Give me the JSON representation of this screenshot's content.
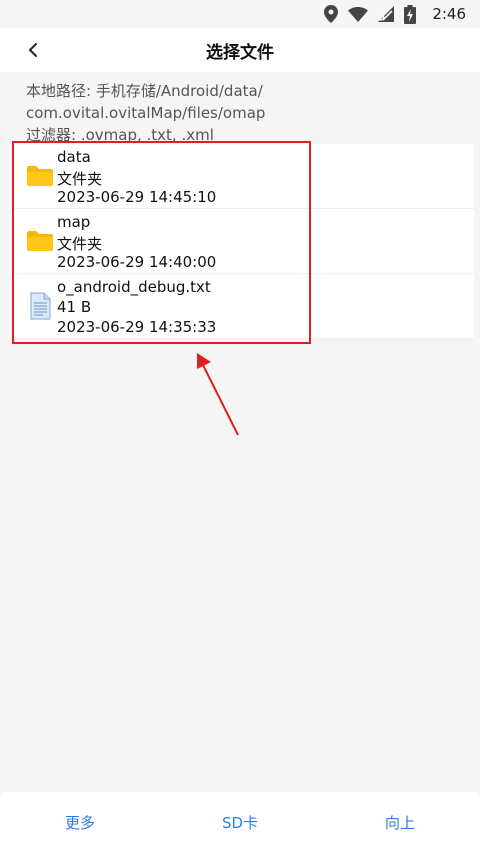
{
  "status": {
    "time": "2:46"
  },
  "header": {
    "title": "选择文件"
  },
  "path_info": {
    "line1": "本地路径: 手机存储/Android/data/",
    "line2": "com.ovital.ovitalMap/files/omap",
    "line3": "过滤器: .ovmap, .txt, .xml"
  },
  "files": [
    {
      "name": "data",
      "type": "文件夹",
      "date": "2023-06-29 14:45:10",
      "icon": "folder-icon"
    },
    {
      "name": "map",
      "type": "文件夹",
      "date": "2023-06-29 14:40:00",
      "icon": "folder-icon"
    },
    {
      "name": "o_android_debug.txt",
      "type": "41 B",
      "date": "2023-06-29 14:35:33",
      "icon": "text-file-icon"
    }
  ],
  "bottom_bar": {
    "more": "更多",
    "sdcard": "SD卡",
    "up": "向上"
  },
  "colors": {
    "accent": "#2e7be6",
    "folder": "#f7b900",
    "annotation": "#e02020"
  }
}
